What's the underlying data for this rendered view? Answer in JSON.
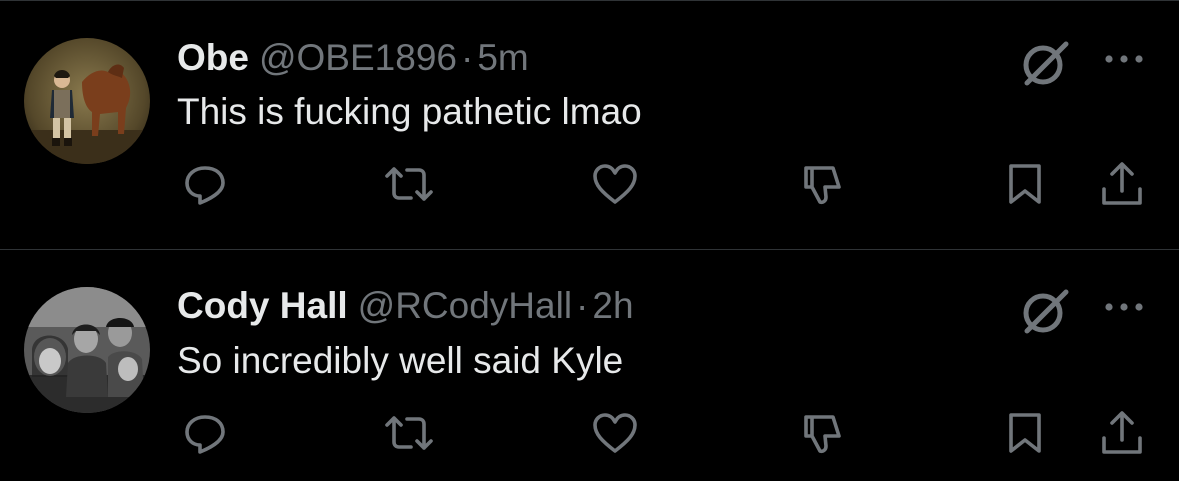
{
  "colors": {
    "background": "#000000",
    "divider": "#2f3336",
    "primary_text": "#e7e9ea",
    "secondary_text": "#71767b"
  },
  "replies": [
    {
      "display_name": "Obe",
      "handle": "@OBE1896",
      "separator": "·",
      "time": "5m",
      "text": "This is fucking pathetic lmao",
      "avatar_icon": "portrait-with-horse-avatar",
      "actions": [
        "reply-icon",
        "repost-icon",
        "like-icon",
        "dislike-icon",
        "bookmark-icon",
        "share-icon"
      ]
    },
    {
      "display_name": "Cody Hall",
      "handle": "@RCodyHall",
      "separator": "·",
      "time": "2h",
      "text": "So incredibly well said Kyle",
      "avatar_icon": "group-photo-avatar",
      "actions": [
        "reply-icon",
        "repost-icon",
        "like-icon",
        "dislike-icon",
        "bookmark-icon",
        "share-icon"
      ]
    }
  ]
}
